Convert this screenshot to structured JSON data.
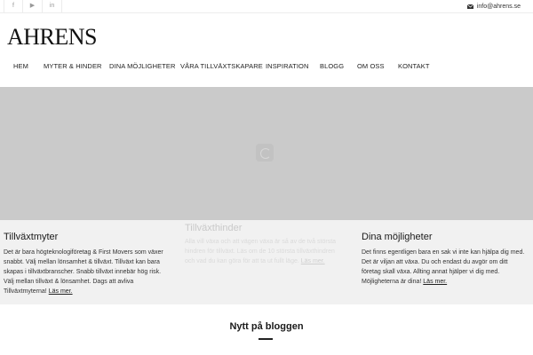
{
  "topbar": {
    "social": [
      {
        "icon": "facebook-icon",
        "glyph": "f"
      },
      {
        "icon": "youtube-icon",
        "glyph": "▶"
      },
      {
        "icon": "linkedin-icon",
        "glyph": "in"
      }
    ],
    "email": "info@ahrens.se"
  },
  "brand": {
    "logo_text": "AHRENS"
  },
  "nav": {
    "items": [
      {
        "label": "HEM"
      },
      {
        "label": "MYTER & HINDER"
      },
      {
        "label": "DINA MÖJLIGHETER"
      },
      {
        "label": "VÅRA TILLVÄXTSKAPARE"
      },
      {
        "label": "INSPIRATION"
      },
      {
        "label": "BLOGG"
      },
      {
        "label": "OM OSS"
      },
      {
        "label": "KONTAKT"
      }
    ]
  },
  "features": [
    {
      "title": "Tillväxtmyter",
      "text": "Det är bara högteknologiföretag & First Movers som växer snabbt. Välj mellan lönsamhet & tillväxt. Tillväxt kan bara skapas i tillväxtbranscher. Snabb tillväxt innebär hög risk. Välj mellan tillväxt & lönsamhet. Dags att avliva Tillväxtmyterna!",
      "more": "Läs mer."
    },
    {
      "title": "Tillväxthinder",
      "text": "Alla vill växa och att vägen växa är så av de två största hindren för tillväxt. Läs om de 10 största tillväxthindren och vad du kan göra för att ta ut fullt läge.",
      "more": "Läs mer."
    },
    {
      "title": "Dina möjligheter",
      "text": "Det finns egentligen bara en sak vi inte kan hjälpa dig med. Det är viljan att växa. Du och endast du avgör om ditt företag skall växa. Allting annat hjälper vi dig med. Möjligheterna är dina!",
      "more": "Läs mer."
    }
  ],
  "blog": {
    "heading": "Nytt på bloggen"
  },
  "colors": {
    "hero": "#cacaca",
    "features_bg": "#f1f1f1",
    "text": "#222222"
  }
}
